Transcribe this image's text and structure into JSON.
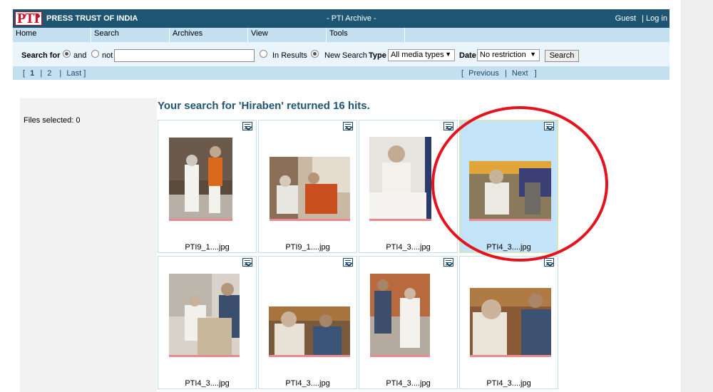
{
  "header": {
    "logo": "PTI",
    "org_name": "PRESS TRUST OF INDIA",
    "app_title": "- PTI Archive -",
    "user": "Guest",
    "separator": "|",
    "login": "Log in"
  },
  "menu": [
    {
      "label": "Home"
    },
    {
      "label": "Search"
    },
    {
      "label": "Archives"
    },
    {
      "label": "View"
    },
    {
      "label": "Tools"
    }
  ],
  "search": {
    "search_for_label": "Search for",
    "and_label": "and",
    "not_label": "not",
    "query_value": "",
    "in_results_label": "In Results",
    "new_search_label": "New Search",
    "type_label": "Type",
    "type_value": "All media types",
    "date_label": "Date",
    "date_value": "No restriction",
    "button_label": "Search"
  },
  "pager": {
    "open_bracket": "[",
    "page_1": "1",
    "sep": "|",
    "page_2": "2",
    "last": "Last",
    "close_bracket": "]",
    "previous": "Previous",
    "next": "Next"
  },
  "sidebar": {
    "files_selected_label": "Files selected: 0"
  },
  "results": {
    "heading": "Your search for 'Hiraben' returned 16 hits.",
    "items": [
      {
        "name": "PTI9_1....jpg"
      },
      {
        "name": "PTI9_1....jpg"
      },
      {
        "name": "PTI4_3....jpg"
      },
      {
        "name": "PTI4_3....jpg"
      },
      {
        "name": "PTI4_3....jpg"
      },
      {
        "name": "PTI4_3....jpg"
      },
      {
        "name": "PTI4_3....jpg"
      },
      {
        "name": "PTI4_3....jpg"
      }
    ]
  },
  "colors": {
    "header_bg": "#1e5572",
    "menu_bg": "#c3dff0",
    "selected_cell": "#c3e3f8",
    "annotation": "#e4141e"
  }
}
